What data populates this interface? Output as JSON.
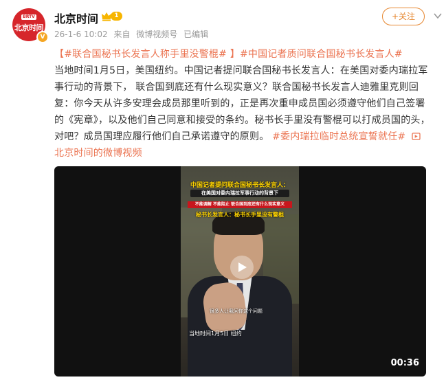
{
  "account": {
    "name": "北京时间",
    "avatar_tag": "BRTV",
    "avatar_text": "北京时间",
    "verified_badge": "V",
    "member_level": "1"
  },
  "meta": {
    "time": "26-1-6 10:02",
    "from_prefix": "来自",
    "source": "微博视频号",
    "edited": "已编辑"
  },
  "follow_button": "+关注",
  "post": {
    "bracket_open": "【",
    "title_topic": "#联合国秘书长发言人称手里没警棍#",
    "bracket_close": " 】",
    "topic2": "#中国记者质问联合国秘书长发言人#",
    "body": "当地时间1月5日，美国纽约。中国记者提问联合国秘书长发言人：在美国对委内瑞拉军事行动的背景下， 联合国到底还有什么现实意义？联合国秘书长发言人迪雅里克则回复：你今天从许多安理会成员那里听到的，正是再次重申成员国必须遵守他们自己签署的《宪章》，以及他们自己同意和接受的条约。秘书长手里没有警棍可以打成员国的头，对吧？成员国理应履行他们自己承诺遵守的原则。",
    "topic3": "#委内瑞拉临时总统宣誓就任#",
    "video_link_icon": "video-link-icon",
    "video_link": "北京时间的微博视频"
  },
  "video": {
    "caption_title": "中国记者提问联合国秘书长发言人：",
    "caption_line2": "在美国对委内瑞拉军事行动的背景下",
    "caption_line3": "不能调解 不能阻止 联合国到底还有什么现实意义",
    "caption_line4": "秘书长发言人：秘书长手里没有警棍",
    "subtitle": "很多人让我问你这个问题",
    "location_text": "当地时间1月5日 纽约",
    "duration": "00:36"
  },
  "colors": {
    "link": "#eb7350",
    "follow": "#e6862e",
    "brand_red": "#d6262b"
  }
}
